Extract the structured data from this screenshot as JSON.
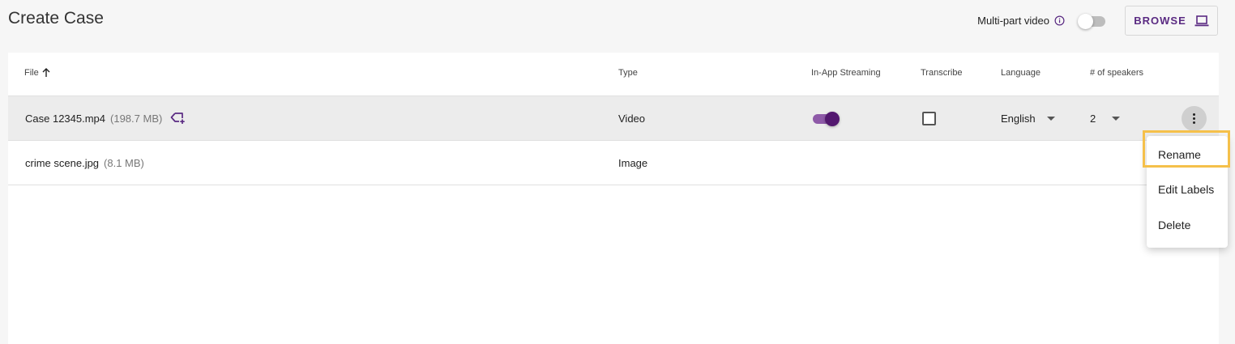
{
  "header": {
    "title": "Create Case",
    "multipart_label": "Multi-part video",
    "multipart_on": false,
    "browse_label": "BROWSE"
  },
  "table": {
    "columns": {
      "file": "File",
      "type": "Type",
      "streaming": "In-App Streaming",
      "transcribe": "Transcribe",
      "language": "Language",
      "speakers": "# of speakers"
    },
    "rows": [
      {
        "name": "Case 12345.mp4",
        "size": "(198.7 MB)",
        "type": "Video",
        "streaming": true,
        "transcribe": false,
        "language": "English",
        "speakers": "2"
      },
      {
        "name": "crime scene.jpg",
        "size": "(8.1 MB)",
        "type": "Image"
      }
    ]
  },
  "context_menu": {
    "items": [
      "Rename",
      "Edit Labels",
      "Delete"
    ],
    "highlighted": "Rename"
  },
  "colors": {
    "accent": "#53186f",
    "highlight": "#f5c04a"
  }
}
